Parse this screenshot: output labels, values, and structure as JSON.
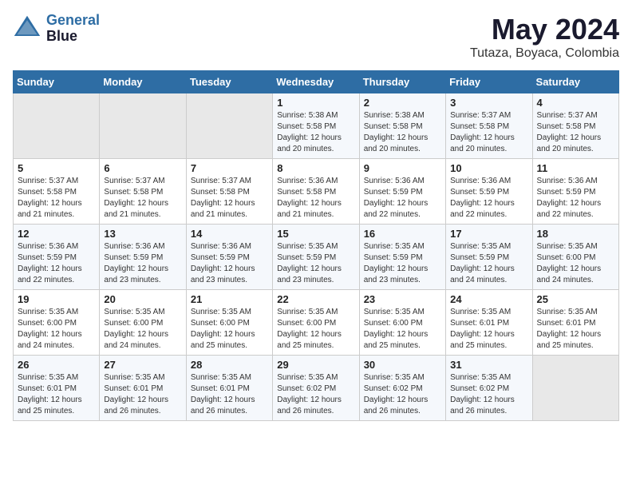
{
  "header": {
    "logo_line1": "General",
    "logo_line2": "Blue",
    "month": "May 2024",
    "location": "Tutaza, Boyaca, Colombia"
  },
  "days_of_week": [
    "Sunday",
    "Monday",
    "Tuesday",
    "Wednesday",
    "Thursday",
    "Friday",
    "Saturday"
  ],
  "weeks": [
    [
      {
        "num": "",
        "info": ""
      },
      {
        "num": "",
        "info": ""
      },
      {
        "num": "",
        "info": ""
      },
      {
        "num": "1",
        "info": "Sunrise: 5:38 AM\nSunset: 5:58 PM\nDaylight: 12 hours\nand 20 minutes."
      },
      {
        "num": "2",
        "info": "Sunrise: 5:38 AM\nSunset: 5:58 PM\nDaylight: 12 hours\nand 20 minutes."
      },
      {
        "num": "3",
        "info": "Sunrise: 5:37 AM\nSunset: 5:58 PM\nDaylight: 12 hours\nand 20 minutes."
      },
      {
        "num": "4",
        "info": "Sunrise: 5:37 AM\nSunset: 5:58 PM\nDaylight: 12 hours\nand 20 minutes."
      }
    ],
    [
      {
        "num": "5",
        "info": "Sunrise: 5:37 AM\nSunset: 5:58 PM\nDaylight: 12 hours\nand 21 minutes."
      },
      {
        "num": "6",
        "info": "Sunrise: 5:37 AM\nSunset: 5:58 PM\nDaylight: 12 hours\nand 21 minutes."
      },
      {
        "num": "7",
        "info": "Sunrise: 5:37 AM\nSunset: 5:58 PM\nDaylight: 12 hours\nand 21 minutes."
      },
      {
        "num": "8",
        "info": "Sunrise: 5:36 AM\nSunset: 5:58 PM\nDaylight: 12 hours\nand 21 minutes."
      },
      {
        "num": "9",
        "info": "Sunrise: 5:36 AM\nSunset: 5:59 PM\nDaylight: 12 hours\nand 22 minutes."
      },
      {
        "num": "10",
        "info": "Sunrise: 5:36 AM\nSunset: 5:59 PM\nDaylight: 12 hours\nand 22 minutes."
      },
      {
        "num": "11",
        "info": "Sunrise: 5:36 AM\nSunset: 5:59 PM\nDaylight: 12 hours\nand 22 minutes."
      }
    ],
    [
      {
        "num": "12",
        "info": "Sunrise: 5:36 AM\nSunset: 5:59 PM\nDaylight: 12 hours\nand 22 minutes."
      },
      {
        "num": "13",
        "info": "Sunrise: 5:36 AM\nSunset: 5:59 PM\nDaylight: 12 hours\nand 23 minutes."
      },
      {
        "num": "14",
        "info": "Sunrise: 5:36 AM\nSunset: 5:59 PM\nDaylight: 12 hours\nand 23 minutes."
      },
      {
        "num": "15",
        "info": "Sunrise: 5:35 AM\nSunset: 5:59 PM\nDaylight: 12 hours\nand 23 minutes."
      },
      {
        "num": "16",
        "info": "Sunrise: 5:35 AM\nSunset: 5:59 PM\nDaylight: 12 hours\nand 23 minutes."
      },
      {
        "num": "17",
        "info": "Sunrise: 5:35 AM\nSunset: 5:59 PM\nDaylight: 12 hours\nand 24 minutes."
      },
      {
        "num": "18",
        "info": "Sunrise: 5:35 AM\nSunset: 6:00 PM\nDaylight: 12 hours\nand 24 minutes."
      }
    ],
    [
      {
        "num": "19",
        "info": "Sunrise: 5:35 AM\nSunset: 6:00 PM\nDaylight: 12 hours\nand 24 minutes."
      },
      {
        "num": "20",
        "info": "Sunrise: 5:35 AM\nSunset: 6:00 PM\nDaylight: 12 hours\nand 24 minutes."
      },
      {
        "num": "21",
        "info": "Sunrise: 5:35 AM\nSunset: 6:00 PM\nDaylight: 12 hours\nand 25 minutes."
      },
      {
        "num": "22",
        "info": "Sunrise: 5:35 AM\nSunset: 6:00 PM\nDaylight: 12 hours\nand 25 minutes."
      },
      {
        "num": "23",
        "info": "Sunrise: 5:35 AM\nSunset: 6:00 PM\nDaylight: 12 hours\nand 25 minutes."
      },
      {
        "num": "24",
        "info": "Sunrise: 5:35 AM\nSunset: 6:01 PM\nDaylight: 12 hours\nand 25 minutes."
      },
      {
        "num": "25",
        "info": "Sunrise: 5:35 AM\nSunset: 6:01 PM\nDaylight: 12 hours\nand 25 minutes."
      }
    ],
    [
      {
        "num": "26",
        "info": "Sunrise: 5:35 AM\nSunset: 6:01 PM\nDaylight: 12 hours\nand 25 minutes."
      },
      {
        "num": "27",
        "info": "Sunrise: 5:35 AM\nSunset: 6:01 PM\nDaylight: 12 hours\nand 26 minutes."
      },
      {
        "num": "28",
        "info": "Sunrise: 5:35 AM\nSunset: 6:01 PM\nDaylight: 12 hours\nand 26 minutes."
      },
      {
        "num": "29",
        "info": "Sunrise: 5:35 AM\nSunset: 6:02 PM\nDaylight: 12 hours\nand 26 minutes."
      },
      {
        "num": "30",
        "info": "Sunrise: 5:35 AM\nSunset: 6:02 PM\nDaylight: 12 hours\nand 26 minutes."
      },
      {
        "num": "31",
        "info": "Sunrise: 5:35 AM\nSunset: 6:02 PM\nDaylight: 12 hours\nand 26 minutes."
      },
      {
        "num": "",
        "info": ""
      }
    ]
  ]
}
